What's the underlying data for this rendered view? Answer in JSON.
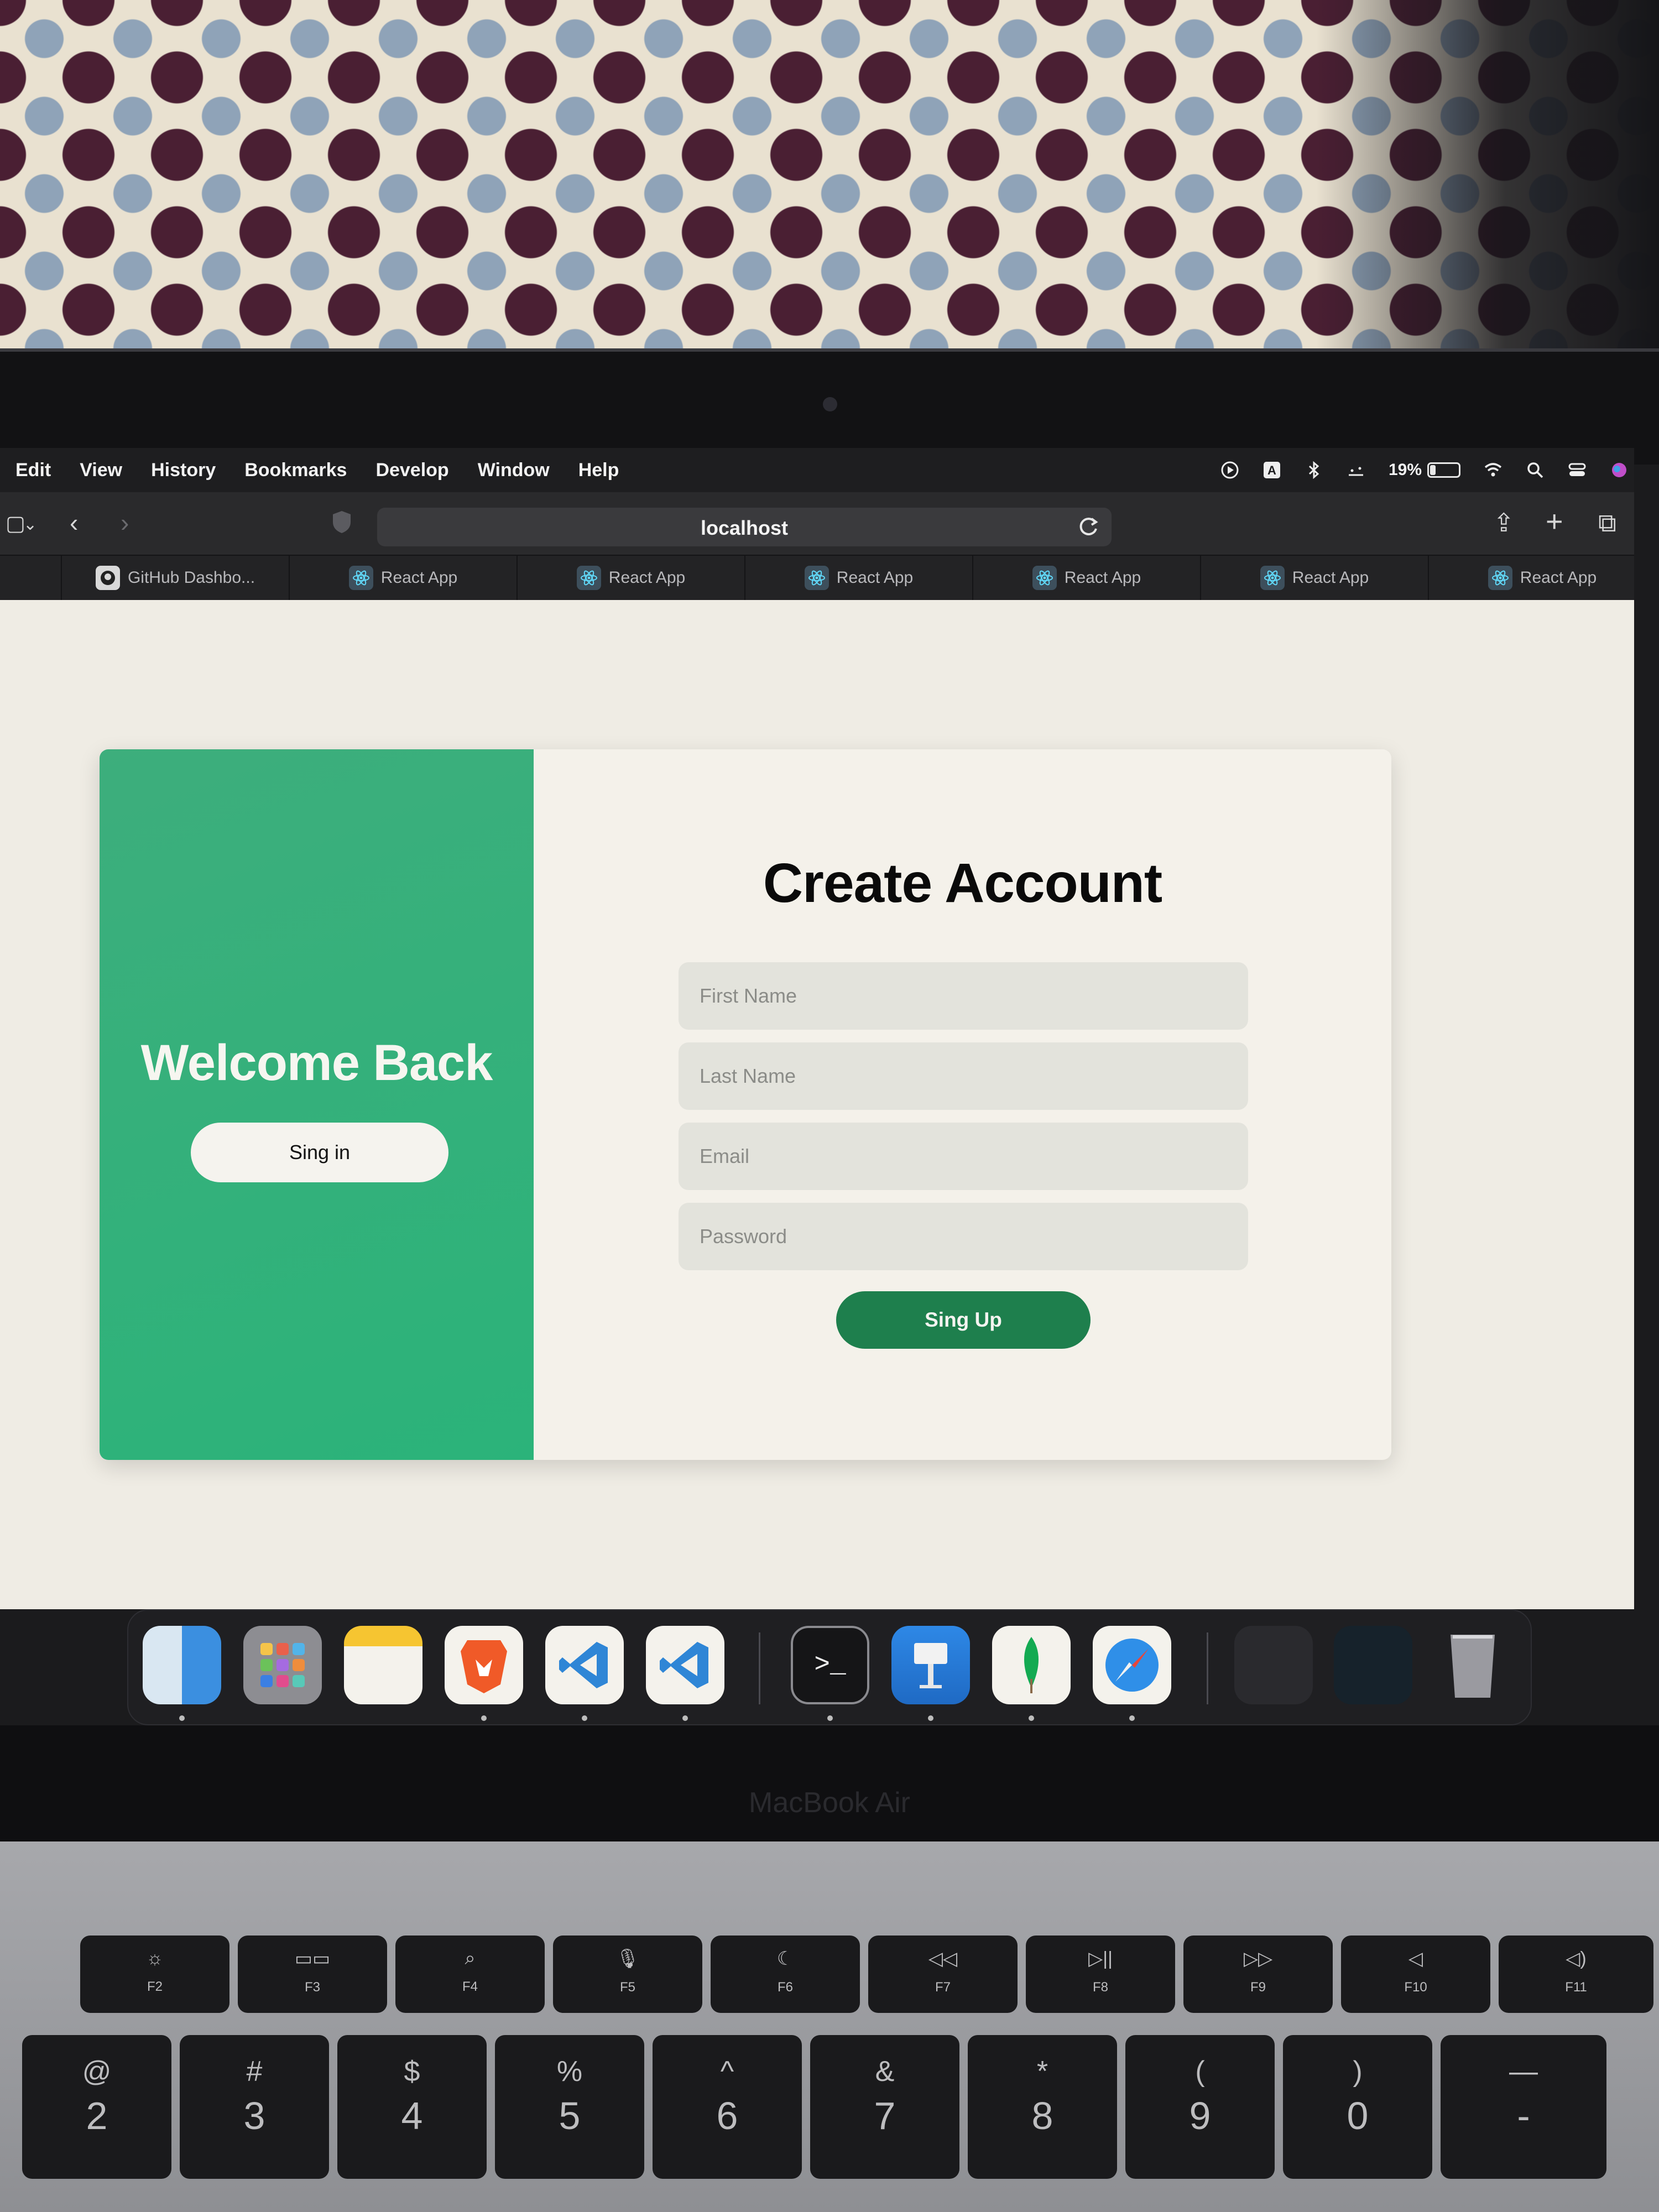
{
  "menubar": {
    "items": [
      "Edit",
      "View",
      "History",
      "Bookmarks",
      "Develop",
      "Window",
      "Help"
    ],
    "battery_percent_label": "19%",
    "battery_level": 0.19
  },
  "browser": {
    "url": "localhost",
    "tabs": [
      {
        "label": "GitHub Dashbo...",
        "icon": "github-icon"
      },
      {
        "label": "React App",
        "icon": "react-icon"
      },
      {
        "label": "React App",
        "icon": "react-icon"
      },
      {
        "label": "React App",
        "icon": "react-icon"
      },
      {
        "label": "React App",
        "icon": "react-icon"
      },
      {
        "label": "React App",
        "icon": "react-icon"
      },
      {
        "label": "React App",
        "icon": "react-icon"
      }
    ]
  },
  "page": {
    "welcome_title": "Welcome Back",
    "signin_button": "Sing in",
    "create_title": "Create Account",
    "fields": {
      "first_name_placeholder": "First Name",
      "last_name_placeholder": "Last Name",
      "email_placeholder": "Email",
      "password_placeholder": "Password"
    },
    "signup_button": "Sing Up",
    "colors": {
      "accent_green": "#2bb37a",
      "button_green": "#1e7f4d",
      "card_background": "#f4f1ea"
    }
  },
  "dock": {
    "apps": [
      "finder-icon",
      "launchpad-icon",
      "notes-icon",
      "brave-icon",
      "vscode-icon",
      "vscode-icon",
      "terminal-icon",
      "keynote-icon",
      "mongodb-compass-icon",
      "safari-icon"
    ]
  },
  "laptop": {
    "brand": "MacBook Air",
    "function_keys": [
      {
        "symbol": "☼",
        "label": "F2"
      },
      {
        "symbol": "▭▭",
        "label": "F3"
      },
      {
        "symbol": "⌕",
        "label": "F4"
      },
      {
        "symbol": "🎙",
        "label": "F5"
      },
      {
        "symbol": "☾",
        "label": "F6"
      },
      {
        "symbol": "◁◁",
        "label": "F7"
      },
      {
        "symbol": "▷||",
        "label": "F8"
      },
      {
        "symbol": "▷▷",
        "label": "F9"
      },
      {
        "symbol": "◁",
        "label": "F10"
      },
      {
        "symbol": "◁)",
        "label": "F11"
      }
    ],
    "number_keys": [
      {
        "top": "@",
        "bottom": "2"
      },
      {
        "top": "#",
        "bottom": "3"
      },
      {
        "top": "$",
        "bottom": "4"
      },
      {
        "top": "%",
        "bottom": "5"
      },
      {
        "top": "^",
        "bottom": "6"
      },
      {
        "top": "&",
        "bottom": "7"
      },
      {
        "top": "*",
        "bottom": "8"
      },
      {
        "top": "(",
        "bottom": "9"
      },
      {
        "top": ")",
        "bottom": "0"
      },
      {
        "top": "—",
        "bottom": "-"
      }
    ]
  }
}
